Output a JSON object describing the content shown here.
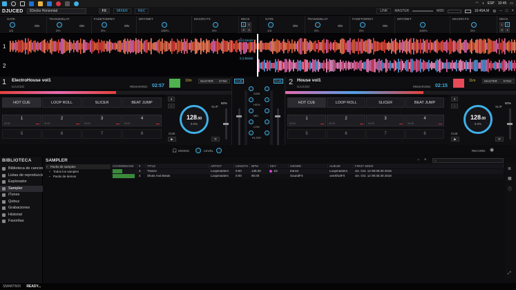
{
  "taskbar": {
    "lang": "ESP",
    "time": "10:45"
  },
  "appbar": {
    "logo": "DJUCED",
    "layout": "2Decks Horizontal",
    "tabs": [
      "FX",
      "MIXER",
      "REC"
    ],
    "link": "LINK",
    "master": "MASTER",
    "midi": "MIDI",
    "time_label": "10:45A.M"
  },
  "fx": {
    "left": {
      "units": [
        {
          "name": "GATE",
          "on": "ON",
          "value": "1/2"
        },
        {
          "name": "TRANSDELAY",
          "on": "ON",
          "value": "0%"
        },
        {
          "name": "FADETODREY",
          "on": "ON",
          "value": "0%"
        },
        {
          "name": "DRY/WET",
          "value": "100%"
        },
        {
          "name": "MACRO FX",
          "value": "0%"
        }
      ],
      "deck_label": "DECK",
      "deck_nums": [
        "1",
        "2",
        "3",
        "4"
      ]
    },
    "right": {
      "units": [
        {
          "name": "GATE",
          "on": "ON",
          "value": "1/2"
        },
        {
          "name": "TRANSDELAY",
          "on": "ON",
          "value": "0%"
        },
        {
          "name": "FADETODREY",
          "on": "ON",
          "value": "0%"
        },
        {
          "name": "DRY/WET",
          "value": "100%"
        },
        {
          "name": "MACRO FX",
          "value": "0%"
        }
      ],
      "deck_label": "DECK",
      "deck_nums": [
        "1",
        "2",
        "3",
        "4"
      ]
    }
  },
  "wave": {
    "label1": "1",
    "label2": "2",
    "beats_top": "20.6 Beats",
    "beats_bot": "1.1 Beats"
  },
  "deck1": {
    "num": "1",
    "title": "ElectroHouse vol1",
    "artist": "DJUCED",
    "remaining_label": "REMAINING",
    "remaining": "02:57",
    "key": "10m",
    "master": "MASTER",
    "sync": "SYNC",
    "bpm": "128",
    "bpm_dec": ".00",
    "pitch": "0.0%",
    "slip": "SLIP",
    "slip_pct": "50%",
    "cue": "CUE",
    "pads_tabs": [
      "HOT CUE",
      "LOOP ROLL",
      "SLICER",
      "BEAT JUMP"
    ],
    "pads": [
      {
        "n": "1",
        "t": "00:00"
      },
      {
        "n": "2",
        "t": "00:07"
      },
      {
        "n": "3",
        "t": "00:22"
      },
      {
        "n": "4",
        "t": "00:07"
      }
    ],
    "pads2": [
      "5",
      "6",
      "7",
      "8"
    ],
    "loop": "4"
  },
  "deck2": {
    "num": "2",
    "title": "House vol1",
    "artist": "DJUCED",
    "remaining_label": "REMAINING",
    "remaining": "02:15",
    "key": "11m",
    "master": "MASTER",
    "sync": "SYNC",
    "bpm": "128",
    "bpm_dec": ".00",
    "pitch": "0.0%",
    "slip": "SLIP",
    "slip_pct": "50%",
    "cue": "CUE",
    "pads_tabs": [
      "HOT CUE",
      "LOOP ROLL",
      "SLICER",
      "BEAT JUMP"
    ],
    "pads": [
      {
        "n": "1",
        "t": "00:00"
      },
      {
        "n": "2",
        "t": "00:15"
      },
      {
        "n": "3",
        "t": "00:30"
      },
      {
        "n": "4",
        "t": "00:45"
      }
    ],
    "pads2": [
      "5",
      "6",
      "7",
      "8"
    ],
    "loop": "4"
  },
  "mixer": {
    "cue_l": "CUE",
    "cue_r": "CUE",
    "labels": [
      "GAIN",
      "HIGH",
      "MID",
      "LOW",
      "FILTER"
    ],
    "mixing": "MIXING",
    "level": "LEVEL",
    "record": "RECORD"
  },
  "browser": {
    "title": "BIBLIOTECA",
    "items": [
      {
        "label": "Biblioteca de canciones",
        "icon": "music-icon"
      },
      {
        "label": "Listas de reproducción",
        "icon": "list-icon"
      },
      {
        "label": "Explorador",
        "icon": "folder-icon"
      },
      {
        "label": "Sampler",
        "icon": "sampler-icon",
        "sel": true
      },
      {
        "label": "iTunes",
        "icon": "itunes-icon"
      },
      {
        "label": "Qobuz",
        "icon": "qobuz-icon"
      },
      {
        "label": "Grabaciones",
        "icon": "mic-icon"
      },
      {
        "label": "Historial",
        "icon": "history-icon"
      },
      {
        "label": "Favoritas",
        "icon": "star-icon"
      }
    ],
    "section": "SAMPLER",
    "tree": [
      "Packs de samples",
      "Todos los samples",
      "Packs de demos"
    ],
    "columns": [
      "COVERIMAGE",
      "#",
      "TITLE",
      "ARTIST",
      "LENGTH",
      "BPM",
      "KEY",
      "GENRE",
      "ALBUM",
      "FIRST SEEN"
    ],
    "rows": [
      {
        "num": "3",
        "title": "Trance",
        "artist": "Loopmasters",
        "length": "0:00",
        "bpm": "135.00",
        "key": "1D",
        "genre": "trance",
        "album": "Loopmasters",
        "first": "vie. Oct. 12 09:35:30 2018"
      },
      {
        "num": "4",
        "title": "Shots And Beats",
        "artist": "Loopmasters",
        "length": "0:00",
        "bpm": "90.00",
        "key": "",
        "genre": "SoundFX",
        "album": "oneShotFX",
        "first": "vie. Oct. 12 09:35:30 2018"
      }
    ]
  },
  "status": {
    "app": "SMARTMIX",
    "state": "READY..."
  },
  "colors": {
    "accent": "#3fb0e6",
    "wave_red": "#e8403a",
    "wave_pink": "#e86ab3"
  }
}
